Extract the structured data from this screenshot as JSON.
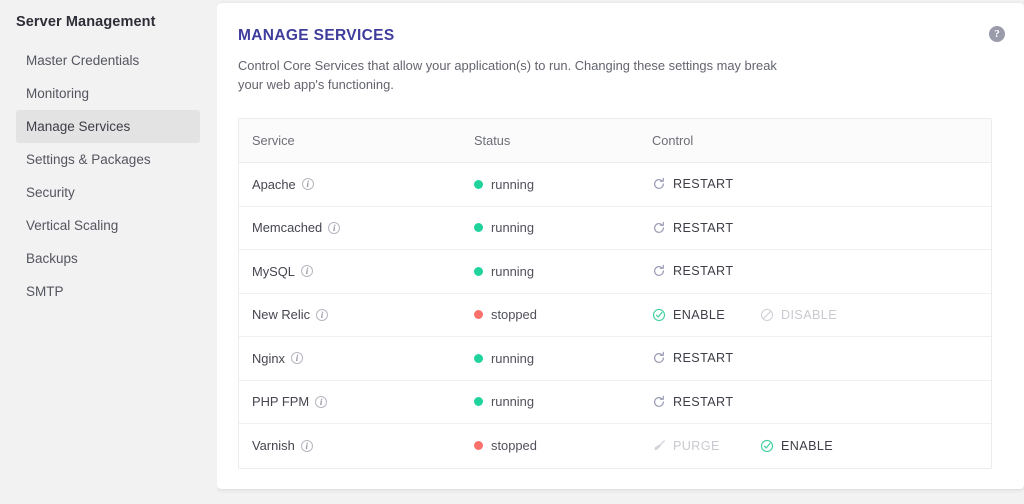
{
  "sidebar": {
    "title": "Server Management",
    "items": [
      {
        "label": "Master Credentials",
        "active": false
      },
      {
        "label": "Monitoring",
        "active": false
      },
      {
        "label": "Manage Services",
        "active": true
      },
      {
        "label": "Settings & Packages",
        "active": false
      },
      {
        "label": "Security",
        "active": false
      },
      {
        "label": "Vertical Scaling",
        "active": false
      },
      {
        "label": "Backups",
        "active": false
      },
      {
        "label": "SMTP",
        "active": false
      }
    ]
  },
  "card": {
    "title": "MANAGE SERVICES",
    "description": "Control Core Services that allow your application(s) to run. Changing these settings may break your web app's functioning.",
    "help_icon": "question-mark-icon",
    "help_glyph": "?"
  },
  "table": {
    "columns": [
      "Service",
      "Status",
      "Control"
    ],
    "rows": [
      {
        "service": "Apache",
        "info_icon": "info-icon",
        "status": "running",
        "status_color": "#20d29b",
        "actions": [
          {
            "label": "RESTART",
            "icon": "refresh-icon",
            "state": "enabled"
          }
        ]
      },
      {
        "service": "Memcached",
        "info_icon": "info-icon",
        "status": "running",
        "status_color": "#20d29b",
        "actions": [
          {
            "label": "RESTART",
            "icon": "refresh-icon",
            "state": "enabled"
          }
        ]
      },
      {
        "service": "MySQL",
        "info_icon": "info-icon",
        "status": "running",
        "status_color": "#20d29b",
        "actions": [
          {
            "label": "RESTART",
            "icon": "refresh-icon",
            "state": "enabled"
          }
        ]
      },
      {
        "service": "New Relic",
        "info_icon": "info-icon",
        "status": "stopped",
        "status_color": "#f9716b",
        "actions": [
          {
            "label": "ENABLE",
            "icon": "check-circle-icon",
            "state": "enabled"
          },
          {
            "label": "DISABLE",
            "icon": "ban-circle-icon",
            "state": "disabled"
          }
        ]
      },
      {
        "service": "Nginx",
        "info_icon": "info-icon",
        "status": "running",
        "status_color": "#20d29b",
        "actions": [
          {
            "label": "RESTART",
            "icon": "refresh-icon",
            "state": "enabled"
          }
        ]
      },
      {
        "service": "PHP FPM",
        "info_icon": "info-icon",
        "status": "running",
        "status_color": "#20d29b",
        "actions": [
          {
            "label": "RESTART",
            "icon": "refresh-icon",
            "state": "enabled"
          }
        ]
      },
      {
        "service": "Varnish",
        "info_icon": "info-icon",
        "status": "stopped",
        "status_color": "#f9716b",
        "actions": [
          {
            "label": "PURGE",
            "icon": "broom-icon",
            "state": "disabled"
          },
          {
            "label": "ENABLE",
            "icon": "check-circle-icon",
            "state": "enabled"
          }
        ]
      }
    ]
  },
  "colors": {
    "accent_title": "#3f3d9c",
    "running": "#20d29b",
    "stopped": "#f9716b",
    "icon_muted": "#9b9cb4",
    "icon_check": "#3ecfa0",
    "disabled_text": "#c9cacf"
  }
}
